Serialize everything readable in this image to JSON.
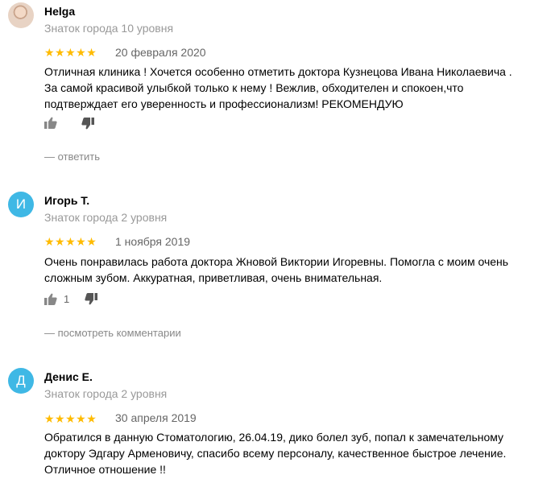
{
  "reviews": [
    {
      "avatar_letter": "",
      "name": "Helga",
      "level": "Знаток города 10 уровня",
      "rating": 5,
      "stars": "★★★★★",
      "date": "20 февраля 2020",
      "text": [
        "Отличная клиника ! Хочется особенно отметить доктора Кузнецова Ивана Николаевича .",
        "За самой красивой улыбкой только к нему ! Вежлив, обходителен и спокоен,что",
        "подтверждает его уверенность и профессионализм! РЕКОМЕНДУЮ"
      ],
      "likes": "",
      "action": "— ответить"
    },
    {
      "avatar_letter": "И",
      "name": "Игорь Т.",
      "level": "Знаток города 2 уровня",
      "rating": 5,
      "stars": "★★★★★",
      "date": "1 ноября 2019",
      "text": [
        "Очень понравилась работа доктора Жновой Виктории Игоревны. Помогла с моим очень",
        "сложным зубом. Аккуратная, приветливая, очень внимательная."
      ],
      "likes": "1",
      "action": "— посмотреть комментарии"
    },
    {
      "avatar_letter": "Д",
      "name": "Денис Е.",
      "level": "Знаток города 2 уровня",
      "rating": 5,
      "stars": "★★★★★",
      "date": "30 апреля 2019",
      "text": [
        "Обратился в данную Стоматологию, 26.04.19, дико болел зуб, попал к замечательному",
        "доктору Эдгару Арменовичу, спасибо всему персоналу, качественное быстрое лечение.",
        "Отличное отношение !!"
      ],
      "likes": "",
      "action": ""
    }
  ],
  "colors": {
    "star": "#ffbb00",
    "avatar_bg": "#3fb8e5",
    "muted_text": "#999999"
  },
  "icons": {
    "like": "thumbs-up-icon",
    "dislike": "thumbs-down-icon"
  }
}
